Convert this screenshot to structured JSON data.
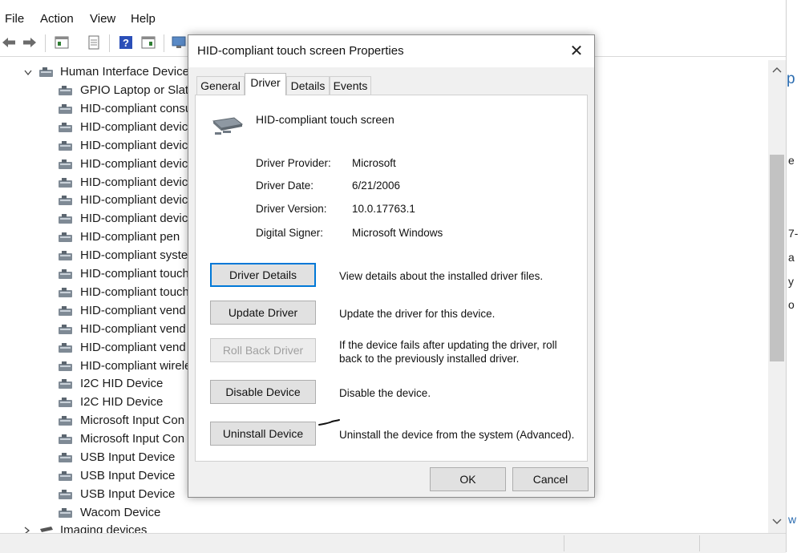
{
  "menu": [
    "File",
    "Action",
    "View",
    "Help"
  ],
  "tree": {
    "category": "Human Interface Devices",
    "items": [
      "GPIO Laptop or Slate",
      "HID-compliant consu",
      "HID-compliant devic",
      "HID-compliant devic",
      "HID-compliant devic",
      "HID-compliant devic",
      "HID-compliant devic",
      "HID-compliant devic",
      "HID-compliant pen",
      "HID-compliant syste",
      "HID-compliant touch",
      "HID-compliant touch",
      "HID-compliant vend",
      "HID-compliant vend",
      "HID-compliant vend",
      "HID-compliant wirele",
      "I2C HID Device",
      "I2C HID Device",
      "Microsoft Input Con",
      "Microsoft Input Con",
      "USB Input Device",
      "USB Input Device",
      "USB Input Device",
      "Wacom Device"
    ],
    "next_category": "Imaging devices"
  },
  "dialog": {
    "title": "HID-compliant touch screen Properties",
    "close": "✕",
    "tabs": [
      "General",
      "Driver",
      "Details",
      "Events"
    ],
    "active_tab": "Driver",
    "device_name": "HID-compliant touch screen",
    "info": [
      {
        "label": "Driver Provider:",
        "value": "Microsoft"
      },
      {
        "label": "Driver Date:",
        "value": "6/21/2006"
      },
      {
        "label": "Driver Version:",
        "value": "10.0.17763.1"
      },
      {
        "label": "Digital Signer:",
        "value": "Microsoft Windows"
      }
    ],
    "actions": [
      {
        "button": "Driver Details",
        "description": "View details about the installed driver files."
      },
      {
        "button": "Update Driver",
        "description": "Update the driver for this device."
      },
      {
        "button": "Roll Back Driver",
        "description": "If the device fails after updating the driver, roll back to the previously installed driver."
      },
      {
        "button": "Disable Device",
        "description": "Disable the device."
      },
      {
        "button": "Uninstall Device",
        "description": "Uninstall the device from the system (Advanced)."
      }
    ],
    "ok": "OK",
    "cancel": "Cancel"
  },
  "colors": {
    "focus_border": "#0078d7",
    "disabled_text": "#a0a0a0",
    "dialog_bg": "#f0f0f0"
  }
}
